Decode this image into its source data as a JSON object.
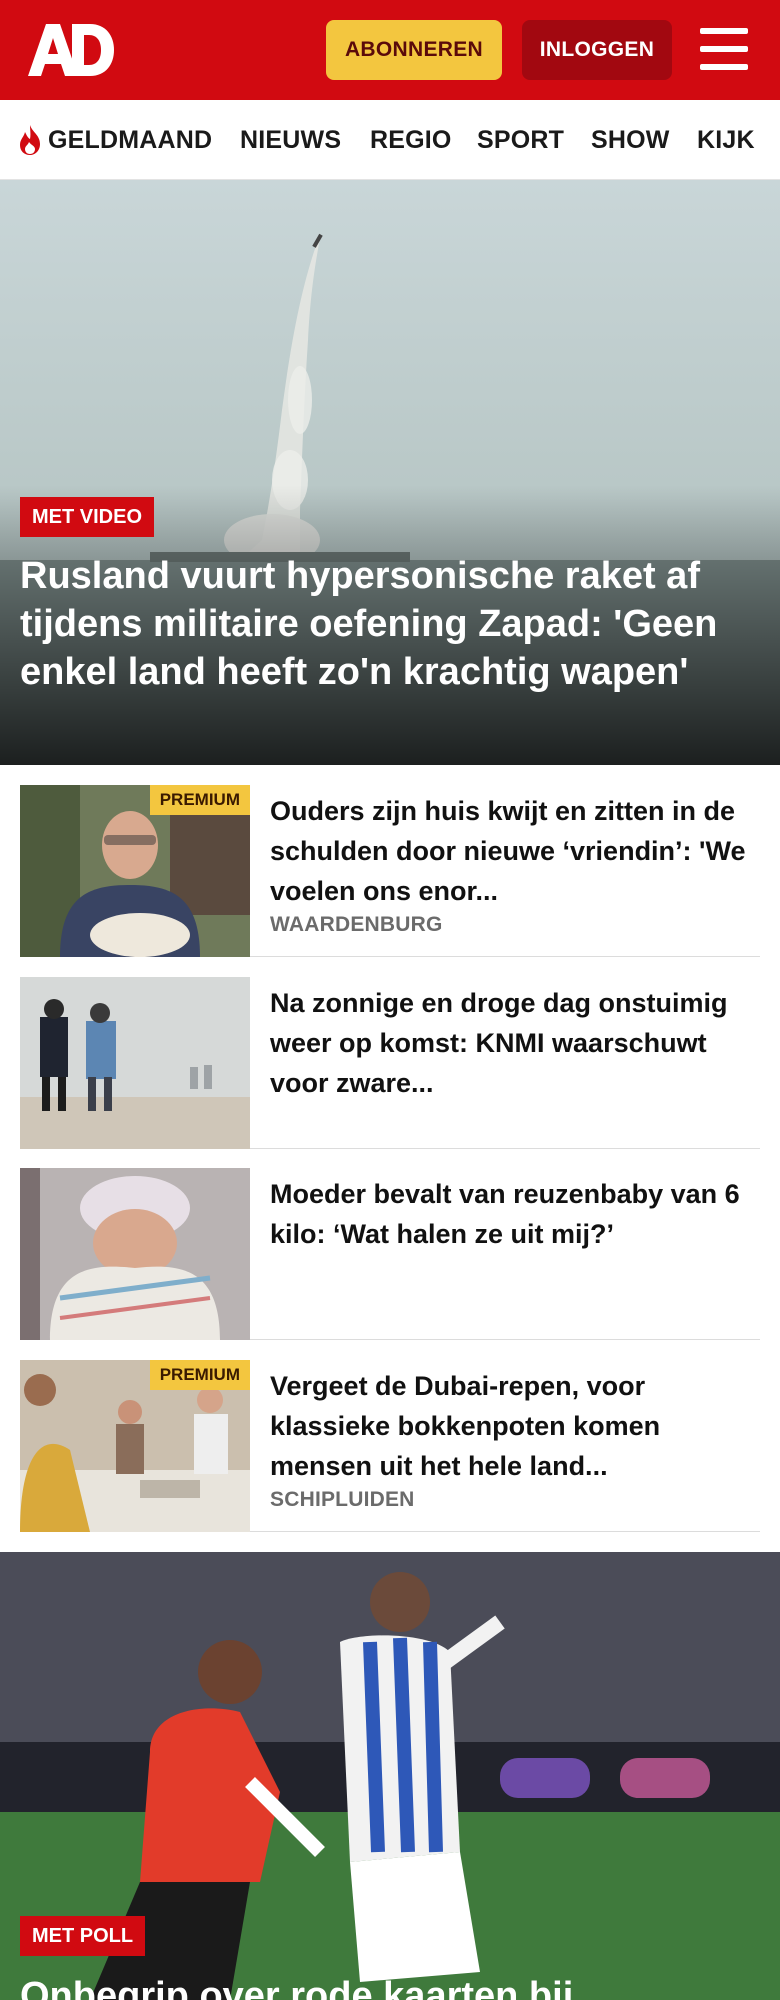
{
  "header": {
    "logo": "AD",
    "subscribe_label": "ABONNEREN",
    "login_label": "INLOGGEN",
    "brand_color": "#d10a11"
  },
  "nav": {
    "items": [
      {
        "label": "GELDMAAND",
        "icon": "flame-icon"
      },
      {
        "label": "NIEUWS"
      },
      {
        "label": "REGIO"
      },
      {
        "label": "SPORT"
      },
      {
        "label": "SHOW"
      },
      {
        "label": "KIJK"
      }
    ]
  },
  "hero": {
    "badge": "MET VIDEO",
    "title": "Rusland vuurt hypersonische raket af tijdens militaire oefening Zapad: 'Geen enkel land heeft zo'n krachtig wapen'"
  },
  "articles": [
    {
      "premium": "PREMIUM",
      "title": "Ouders zijn huis kwijt en zitten in de schulden door nieuwe ‘vriendin’: 'We voelen ons enor...",
      "location": "WAARDENBURG"
    },
    {
      "title": "Na zonnige en droge dag onstuimig weer op komst: KNMI waarschuwt voor zware..."
    },
    {
      "title": "Moeder bevalt van reuzenbaby van 6 kilo: ‘Wat halen ze uit mij?’"
    },
    {
      "premium": "PREMIUM",
      "title": "Vergeet de Dubai-repen, voor klassieke bokkenpoten komen mensen uit het hele land...",
      "location": "SCHIPLUIDEN"
    }
  ],
  "hero2": {
    "badge": "MET POLL",
    "title": "Onbegrip over rode kaarten bij"
  }
}
